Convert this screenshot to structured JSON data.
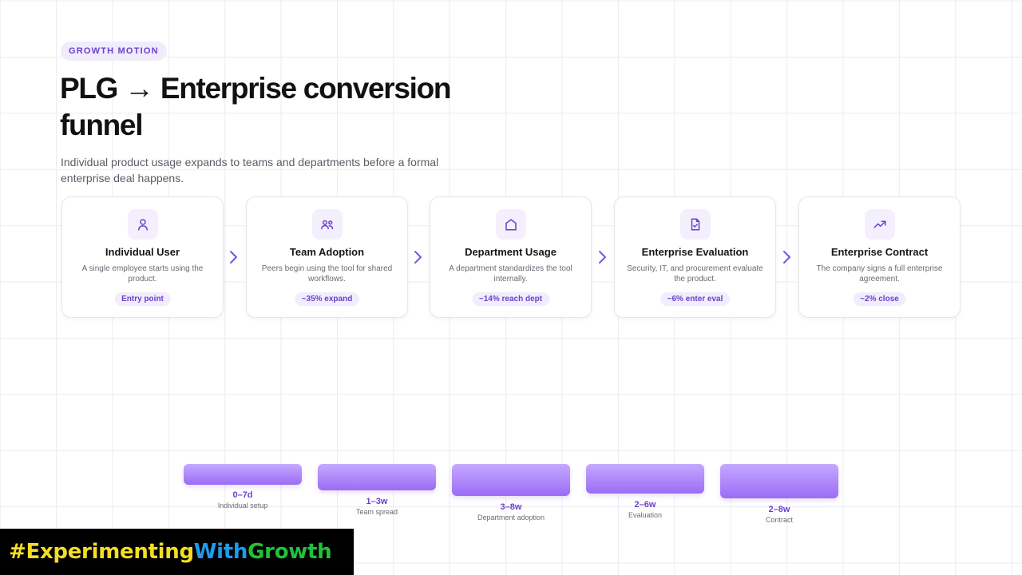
{
  "header": {
    "eyebrow": "GROWTH MOTION",
    "title": "PLG → Enterprise conversion funnel",
    "subtitle": "Individual product usage expands to teams and departments before a formal enterprise deal happens."
  },
  "accent_color": "#6b3fd1",
  "stages": [
    {
      "icon": "user-icon",
      "name": "Individual User",
      "desc": "A single employee starts using the product.",
      "metric": "Entry point"
    },
    {
      "icon": "team-icon",
      "name": "Team Adoption",
      "desc": "Peers begin using the tool for shared workflows.",
      "metric": "~35% expand"
    },
    {
      "icon": "building-icon",
      "name": "Department Usage",
      "desc": "A department standardizes the tool internally.",
      "metric": "~14% reach dept"
    },
    {
      "icon": "document-check-icon",
      "name": "Enterprise Evaluation",
      "desc": "Security, IT, and procurement evaluate the product.",
      "metric": "~6% enter eval"
    },
    {
      "icon": "trend-icon",
      "name": "Enterprise Contract",
      "desc": "The company signs a full enterprise agreement.",
      "metric": "~2% close"
    }
  ],
  "timeline": [
    {
      "duration": "0–7d",
      "label": "Individual setup"
    },
    {
      "duration": "1–3w",
      "label": "Team spread"
    },
    {
      "duration": "3–8w",
      "label": "Department adoption"
    },
    {
      "duration": "2–6w",
      "label": "Evaluation"
    },
    {
      "duration": "2–8w",
      "label": "Contract"
    }
  ],
  "brand": {
    "parts": [
      {
        "text": "#Experimenting",
        "color": "#f5dd24"
      },
      {
        "text": "With",
        "color": "#1e9bf0"
      },
      {
        "text": "Growth",
        "color": "#22c13a"
      }
    ]
  }
}
